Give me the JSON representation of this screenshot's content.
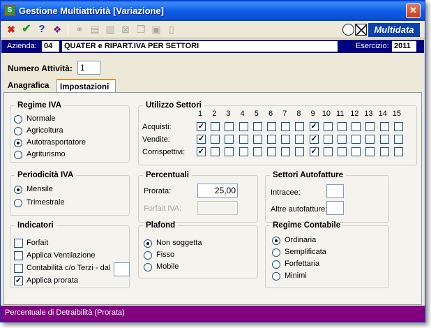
{
  "window": {
    "title": "Gestione Multiattività [Variazione]",
    "close": "✕"
  },
  "toolbar": {
    "icons": [
      "close-red-x",
      "confirm-check",
      "help-question",
      "book",
      "binoculars",
      "print",
      "print-preview",
      "cancel-document",
      "copy",
      "paste",
      "new-document"
    ],
    "logo_text": "Multidata"
  },
  "azienda": {
    "label": "Azienda:",
    "code": "04",
    "name": "QUATER e RIPART.IVA PER SETTORI",
    "esercizio_label": "Esercizio:",
    "esercizio": "2011"
  },
  "numero_attivita": {
    "label": "Numero Attività:",
    "value": "1"
  },
  "tabs": [
    {
      "label": "Anagrafica",
      "active": false
    },
    {
      "label": "Impostazioni",
      "active": true
    }
  ],
  "regime_iva": {
    "title": "Regime IVA",
    "options": [
      "Normale",
      "Agricoltura",
      "Autotrasportatore",
      "Agriturismo"
    ],
    "selected": 2
  },
  "utilizzo_settori": {
    "title": "Utilizzo Settori",
    "columns": [
      "1",
      "2",
      "3",
      "4",
      "5",
      "6",
      "7",
      "8",
      "9",
      "10",
      "11",
      "12",
      "13",
      "14",
      "15"
    ],
    "rows": [
      {
        "label": "Acquisti:",
        "checked": [
          1,
          9
        ]
      },
      {
        "label": "Vendite:",
        "checked": [
          1,
          9
        ]
      },
      {
        "label": "Corrispettivi:",
        "checked": [
          1,
          9
        ]
      }
    ]
  },
  "periodicita_iva": {
    "title": "Periodicità IVA",
    "options": [
      "Mensile",
      "Trimestrale"
    ],
    "selected": 0
  },
  "percentuali": {
    "title": "Percentuali",
    "prorata_label": "Prorata:",
    "prorata_value": "25,00",
    "forfait_label": "Forfait IVA:",
    "forfait_value": ""
  },
  "settori_autofatture": {
    "title": "Settori Autofatture",
    "intracee_label": "Intracee:",
    "intracee_value": "",
    "altre_label": "Altre autofatture:",
    "altre_value": ""
  },
  "indicatori": {
    "title": "Indicatori",
    "items": [
      {
        "label": "Forfait",
        "checked": false
      },
      {
        "label": "Applica Ventilazione",
        "checked": false
      },
      {
        "label": "Contabilità c/o Terzi - dal",
        "checked": false
      },
      {
        "label": "Applica prorata",
        "checked": true
      }
    ],
    "terzi_value": ""
  },
  "plafond": {
    "title": "Plafond",
    "options": [
      "Non soggetta",
      "Fisso",
      "Mobile"
    ],
    "selected": 0
  },
  "regime_contabile": {
    "title": "Regime Contabile",
    "options": [
      "Ordinaria",
      "Semplificata",
      "Forfettaria",
      "Minimi"
    ],
    "selected": 0
  },
  "status": {
    "text": "Percentuale di Detraibilità (Prorata)"
  },
  "glyphs": {
    "check": "✓"
  }
}
